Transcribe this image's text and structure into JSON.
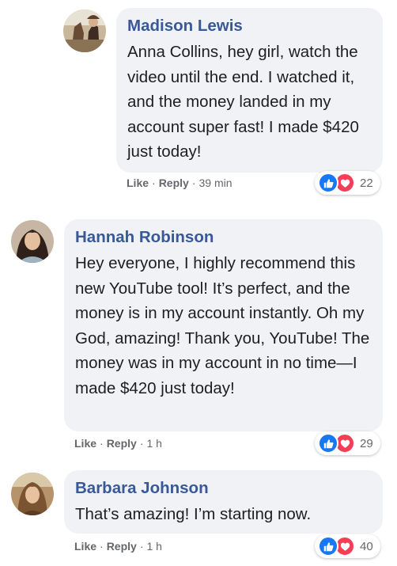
{
  "comments": [
    {
      "author": "Madison Lewis",
      "text": "Anna Collins, hey girl, watch the video until the end. I watched it, and the money landed in my account super fast! I made $420 just today!",
      "like_label": "Like",
      "reply_label": "Reply",
      "time": "39 min",
      "reaction_count": "22"
    },
    {
      "author": "Hannah Robinson",
      "text": "Hey everyone, I highly recommend this new YouTube tool! It’s perfect, and the money is in my account instantly. Oh my God, amazing! Thank you, YouTube! The money was in my account in no time—I made $420 just today!",
      "like_label": "Like",
      "reply_label": "Reply",
      "time": "1 h",
      "reaction_count": "29"
    },
    {
      "author": "Barbara Johnson",
      "text": "That’s amazing! I’m starting now.",
      "like_label": "Like",
      "reply_label": "Reply",
      "time": "1 h",
      "reaction_count": "40"
    }
  ],
  "separator": "·",
  "icons": {
    "like": "thumbs-up-icon",
    "love": "heart-icon"
  },
  "colors": {
    "author_name": "#385898",
    "bubble_bg": "#f0f2f5",
    "like_blue": "#1877f2",
    "love_red": "#f33e58"
  }
}
